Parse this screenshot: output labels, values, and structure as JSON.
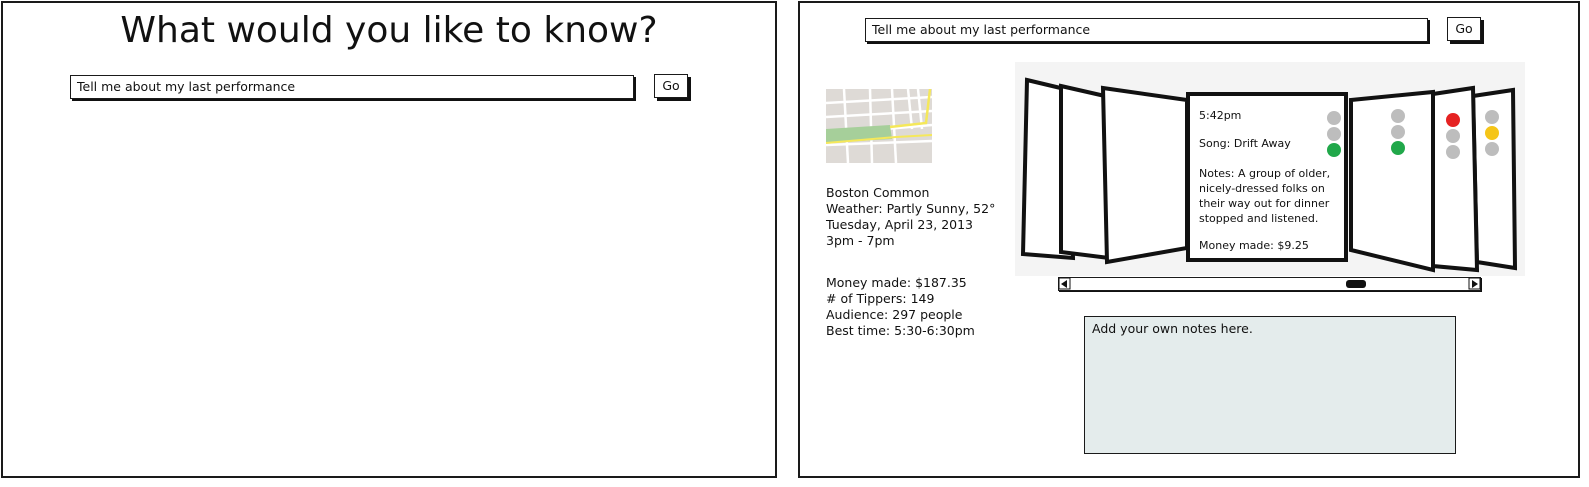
{
  "left_screen": {
    "title": "What would you like to know?",
    "search": {
      "value": "Tell me about my last performance"
    },
    "go_label": "Go"
  },
  "right_screen": {
    "search": {
      "value": "Tell me about my last performance"
    },
    "go_label": "Go",
    "location": {
      "place": "Boston Common",
      "weather": "Weather: Partly Sunny, 52°",
      "date": "Tuesday, April 23, 2013",
      "time": "3pm - 7pm"
    },
    "stats": {
      "money": "Money made: $187.35",
      "tippers": "# of Tippers: 149",
      "audience": "Audience: 297 people",
      "best_time": "Best time: 5:30-6:30pm"
    },
    "card": {
      "time": "5:42pm",
      "song": "Song: Drift Away",
      "notes": [
        "Notes: A group of older,",
        "nicely-dressed folks on",
        "their way out for dinner",
        "stopped and listened."
      ],
      "money": "Money made: $9.25"
    },
    "notes_placeholder": "Add your own notes here.",
    "colors": {
      "red": "#e52222",
      "yellow": "#f5c518",
      "green": "#21a84a",
      "gray": "#bdbdbd",
      "notes_bg": "#e4ecec"
    }
  }
}
